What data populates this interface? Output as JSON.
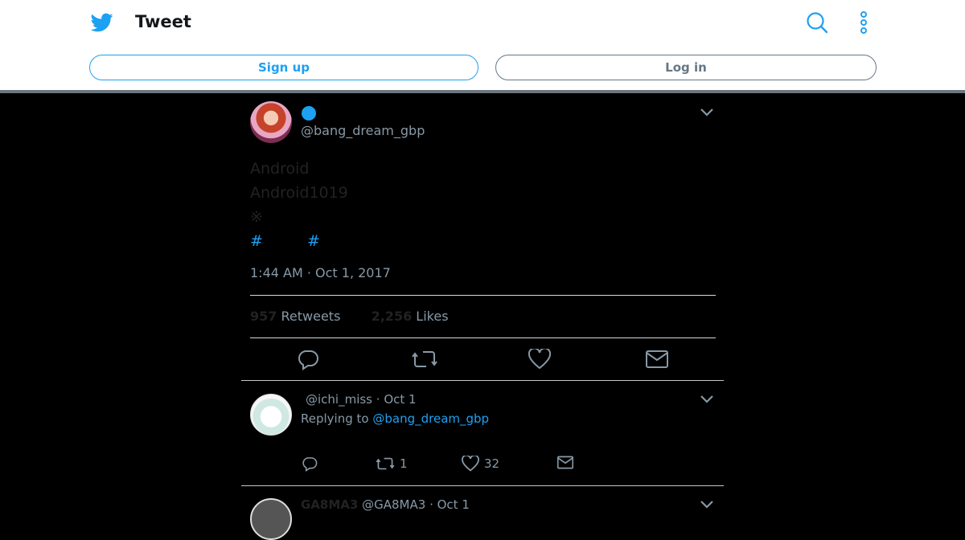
{
  "header": {
    "title": "Tweet",
    "signup_label": "Sign up",
    "login_label": "Log in",
    "logo_icon": "twitter-bird-icon",
    "search_icon": "search-icon",
    "more_icon": "more-vertical-icon",
    "accent_color": "#1da1f2"
  },
  "tweet": {
    "handle": "@bang_dream_gbp",
    "text_lines": [
      "Android",
      "Android1019",
      "※"
    ],
    "hashtags": [
      "#",
      "#"
    ],
    "timestamp": "1:44 AM · Oct 1, 2017",
    "retweets_count": "957",
    "retweets_label": "Retweets",
    "likes_count": "2,256",
    "likes_label": "Likes",
    "actions": [
      "reply-icon",
      "retweet-icon",
      "like-icon",
      "message-icon"
    ]
  },
  "replies": [
    {
      "handle": "@ichi_miss",
      "date": "Oct 1",
      "replying_prefix": "Replying to",
      "replying_to": "@bang_dream_gbp",
      "retweet_count": "1",
      "like_count": "32"
    },
    {
      "name": "GA8MA3",
      "handle": "@GA8MA3",
      "date": "Oct 1"
    }
  ]
}
